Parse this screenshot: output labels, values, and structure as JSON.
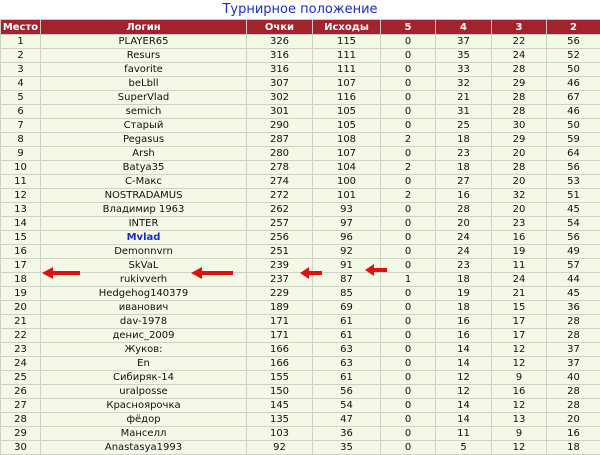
{
  "page_title": "Турнирное положение",
  "columns": [
    "Место",
    "Логин",
    "Очки",
    "Исходы",
    "5",
    "4",
    "3",
    "2"
  ],
  "highlight_login": "Mvlad",
  "colors": {
    "header_bg": "#a2232b",
    "row_bg": "#f3f9e6",
    "title": "#1a2fc0",
    "highlight": "#1830c8",
    "arrow": "#e01010"
  },
  "rows": [
    [
      "1",
      "PLAYER65",
      "326",
      "115",
      "0",
      "37",
      "22",
      "56"
    ],
    [
      "2",
      "Resurs",
      "316",
      "111",
      "0",
      "35",
      "24",
      "52"
    ],
    [
      "3",
      "favorite",
      "316",
      "111",
      "0",
      "33",
      "28",
      "50"
    ],
    [
      "4",
      "beLbll",
      "307",
      "107",
      "0",
      "32",
      "29",
      "46"
    ],
    [
      "5",
      "SuperVlad",
      "302",
      "116",
      "0",
      "21",
      "28",
      "67"
    ],
    [
      "6",
      "semich",
      "301",
      "105",
      "0",
      "31",
      "28",
      "46"
    ],
    [
      "7",
      "Старый",
      "290",
      "105",
      "0",
      "25",
      "30",
      "50"
    ],
    [
      "8",
      "Pegasus",
      "287",
      "108",
      "2",
      "18",
      "29",
      "59"
    ],
    [
      "9",
      "Arsh",
      "280",
      "107",
      "0",
      "23",
      "20",
      "64"
    ],
    [
      "10",
      "Batya35",
      "278",
      "104",
      "2",
      "18",
      "28",
      "56"
    ],
    [
      "11",
      "С-Макс",
      "274",
      "100",
      "0",
      "27",
      "20",
      "53"
    ],
    [
      "12",
      "NOSTRADAMUS",
      "272",
      "101",
      "2",
      "16",
      "32",
      "51"
    ],
    [
      "13",
      "Владимир 1963",
      "262",
      "93",
      "0",
      "28",
      "20",
      "45"
    ],
    [
      "14",
      "INTER",
      "257",
      "97",
      "0",
      "20",
      "23",
      "54"
    ],
    [
      "15",
      "Mvlad",
      "256",
      "96",
      "0",
      "24",
      "16",
      "56"
    ],
    [
      "16",
      "Demonnvrn",
      "251",
      "92",
      "0",
      "24",
      "19",
      "49"
    ],
    [
      "17",
      "SkVaL",
      "239",
      "91",
      "0",
      "23",
      "11",
      "57"
    ],
    [
      "18",
      "rukivverh",
      "237",
      "87",
      "1",
      "18",
      "24",
      "44"
    ],
    [
      "19",
      "Hedgehog140379",
      "229",
      "85",
      "0",
      "19",
      "21",
      "45"
    ],
    [
      "20",
      "иванович",
      "189",
      "69",
      "0",
      "18",
      "15",
      "36"
    ],
    [
      "21",
      "dav-1978",
      "171",
      "61",
      "0",
      "16",
      "17",
      "28"
    ],
    [
      "22",
      "денис_2009",
      "171",
      "61",
      "0",
      "16",
      "17",
      "28"
    ],
    [
      "23",
      "Жуков:",
      "166",
      "63",
      "0",
      "14",
      "12",
      "37"
    ],
    [
      "24",
      "En",
      "166",
      "63",
      "0",
      "14",
      "12",
      "37"
    ],
    [
      "25",
      "Сибиряк-14",
      "155",
      "61",
      "0",
      "12",
      "9",
      "40"
    ],
    [
      "26",
      "uralposse",
      "150",
      "56",
      "0",
      "12",
      "16",
      "28"
    ],
    [
      "27",
      "Красноярочка",
      "145",
      "54",
      "0",
      "14",
      "12",
      "28"
    ],
    [
      "28",
      "фёдор",
      "135",
      "47",
      "0",
      "14",
      "13",
      "20"
    ],
    [
      "29",
      "Манселл",
      "103",
      "36",
      "0",
      "11",
      "9",
      "16"
    ],
    [
      "30",
      "Anastasya1993",
      "92",
      "35",
      "0",
      "5",
      "12",
      "18"
    ]
  ]
}
